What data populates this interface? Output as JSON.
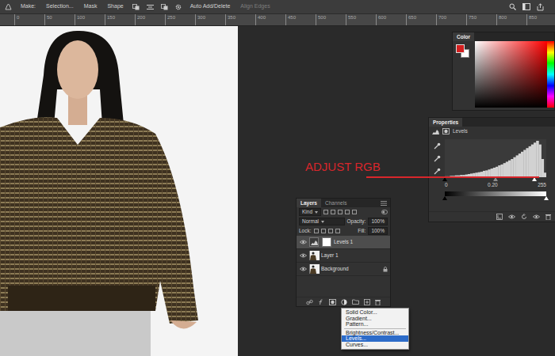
{
  "options_bar": {
    "items": [
      {
        "label": "Make:",
        "disabled": false
      },
      {
        "label": "Selection...",
        "disabled": false
      },
      {
        "label": "Mask",
        "disabled": false
      },
      {
        "label": "Shape",
        "disabled": false
      },
      {
        "label": "Auto Add/Delete",
        "disabled": false
      },
      {
        "label": "Align Edges",
        "disabled": true
      }
    ]
  },
  "ruler": {
    "ticks": [
      "0",
      "50",
      "100",
      "150",
      "200",
      "250",
      "300",
      "350",
      "400",
      "450",
      "500",
      "550",
      "600",
      "650",
      "700",
      "750",
      "800",
      "850"
    ]
  },
  "color_panel": {
    "tab": "Color",
    "foreground_color": "#d41f1f",
    "background_color": "#ffffff"
  },
  "properties": {
    "tab": "Properties",
    "title": "Levels",
    "histogram": [
      2,
      2,
      3,
      3,
      4,
      4,
      5,
      5,
      6,
      7,
      8,
      9,
      10,
      11,
      12,
      14,
      15,
      17,
      19,
      21,
      23,
      26,
      28,
      31,
      34,
      37,
      40,
      44,
      48,
      52,
      56,
      60,
      64,
      68,
      72,
      76,
      80,
      72,
      40,
      10
    ],
    "input_sliders": [
      {
        "level": 0
      },
      {
        "level": 0.5
      },
      {
        "level": 0.88
      }
    ],
    "input_values": [
      "0",
      "0.20",
      "255"
    ],
    "output_sliders": [
      {
        "level": 0
      },
      {
        "level": 1
      }
    ]
  },
  "annotation": {
    "text": "ADJUST RGB",
    "color": "#d8262b"
  },
  "layers_panel": {
    "tabs": [
      {
        "label": "Layers",
        "selected": true
      },
      {
        "label": "Channels",
        "selected": false
      }
    ],
    "filter": "Kind",
    "blend_mode": "Normal",
    "opacity_label": "Opacity:",
    "opacity": "100%",
    "lock_label": "Lock:",
    "fill_label": "Fill:",
    "fill": "100%",
    "layers": [
      {
        "name": "Levels 1",
        "kind": "adjustment",
        "selected": true,
        "visible": true,
        "locked": false
      },
      {
        "name": "Layer 1",
        "kind": "pixel",
        "selected": false,
        "visible": true,
        "locked": false
      },
      {
        "name": "Background",
        "kind": "pixel",
        "selected": false,
        "visible": true,
        "locked": true
      }
    ]
  },
  "menu": {
    "items": [
      {
        "kind": "item",
        "label": "Solid Color...",
        "selected": false
      },
      {
        "kind": "item",
        "label": "Gradient...",
        "selected": false
      },
      {
        "kind": "item",
        "label": "Pattern...",
        "selected": false
      },
      {
        "kind": "separator",
        "selected": false
      },
      {
        "kind": "item",
        "label": "Brightness/Contrast...",
        "selected": false
      },
      {
        "kind": "item",
        "label": "Levels...",
        "selected": true
      },
      {
        "kind": "item",
        "label": "Curves...",
        "selected": false
      }
    ]
  }
}
